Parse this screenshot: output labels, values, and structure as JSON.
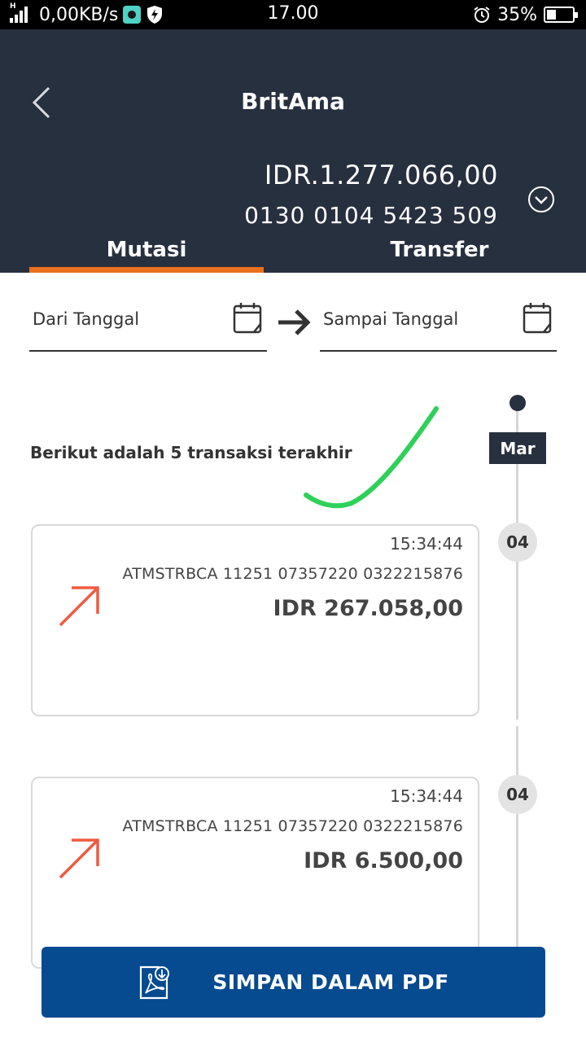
{
  "status_bar": {
    "network_type": "H",
    "net_speed": "0,00KB/s",
    "time": "17.00",
    "battery_percent": "35%",
    "battery_level": 0.35
  },
  "header": {
    "title": "BritAma",
    "balance": "IDR.1.277.066,00",
    "account_number": "0130 0104 5423 509",
    "background_color": "#27303f"
  },
  "tabs": [
    {
      "label": "Mutasi",
      "active": true
    },
    {
      "label": "Transfer",
      "active": false
    }
  ],
  "accent_color": "#e8701f",
  "date_filter": {
    "from_label": "Dari Tanggal",
    "to_label": "Sampai Tanggal"
  },
  "summary_text": "Berikut adalah 5 transaksi terakhir",
  "timeline": {
    "month": "Mar"
  },
  "transactions": [
    {
      "day": "04",
      "time": "15:34:44",
      "description": "ATMSTRBCA 11251 07357220 0322215876",
      "amount": "IDR 267.058,00",
      "direction_icon": "outgoing-arrow-icon"
    },
    {
      "day": "04",
      "time": "15:34:44",
      "description": "ATMSTRBCA 11251 07357220 0322215876",
      "amount": "IDR 6.500,00",
      "direction_icon": "outgoing-arrow-icon"
    }
  ],
  "pdf_button": {
    "label": "SIMPAN DALAM PDF",
    "color": "#064a90"
  }
}
